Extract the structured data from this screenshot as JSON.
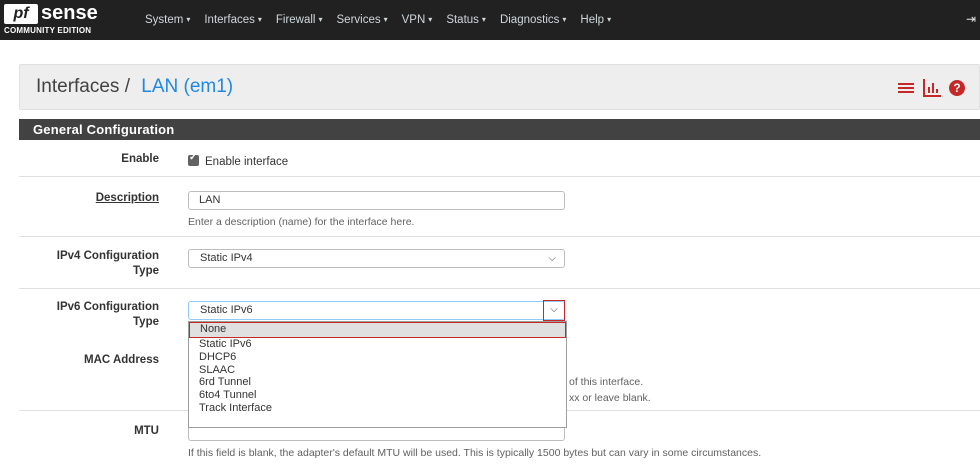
{
  "navbar": {
    "logo_pf": "pf",
    "logo_sense": "sense",
    "logo_edition": "COMMUNITY EDITION",
    "menu": [
      {
        "label": "System"
      },
      {
        "label": "Interfaces"
      },
      {
        "label": "Firewall"
      },
      {
        "label": "Services"
      },
      {
        "label": "VPN"
      },
      {
        "label": "Status"
      },
      {
        "label": "Diagnostics"
      },
      {
        "label": "Help"
      }
    ],
    "caret": "▾",
    "logout_icon": "logout-icon"
  },
  "breadcrumb": {
    "parent": "Interfaces",
    "separator": "/",
    "current": "LAN (em1)",
    "icons": [
      "sliders-icon",
      "chart-icon",
      "help-icon"
    ],
    "help_glyph": "?"
  },
  "panel": {
    "title": "General Configuration",
    "enable": {
      "label": "Enable",
      "checkbox_label": "Enable interface",
      "checked": true
    },
    "description": {
      "label": "Description",
      "value": "LAN",
      "help": "Enter a description (name) for the interface here."
    },
    "ipv4": {
      "label_line1": "IPv4 Configuration",
      "label_line2": "Type",
      "value": "Static IPv4"
    },
    "ipv6": {
      "label_line1": "IPv6 Configuration",
      "label_line2": "Type",
      "value": "Static IPv6",
      "options": [
        "None",
        "Static IPv6",
        "DHCP6",
        "SLAAC",
        "6rd Tunnel",
        "6to4 Tunnel",
        "Track Interface"
      ],
      "highlighted": "None"
    },
    "mac": {
      "label": "MAC Address",
      "help_partial_1": "of this interface.",
      "help_partial_2": "xx or leave blank."
    },
    "mtu": {
      "label": "MTU",
      "help": "If this field is blank, the adapter's default MTU will be used. This is typically 1500 bytes but can vary in some circumstances."
    }
  },
  "colors": {
    "navbar": "#212121",
    "accent_red": "#c62828",
    "link_blue": "#1e88e5",
    "panel_heading": "#424242"
  }
}
